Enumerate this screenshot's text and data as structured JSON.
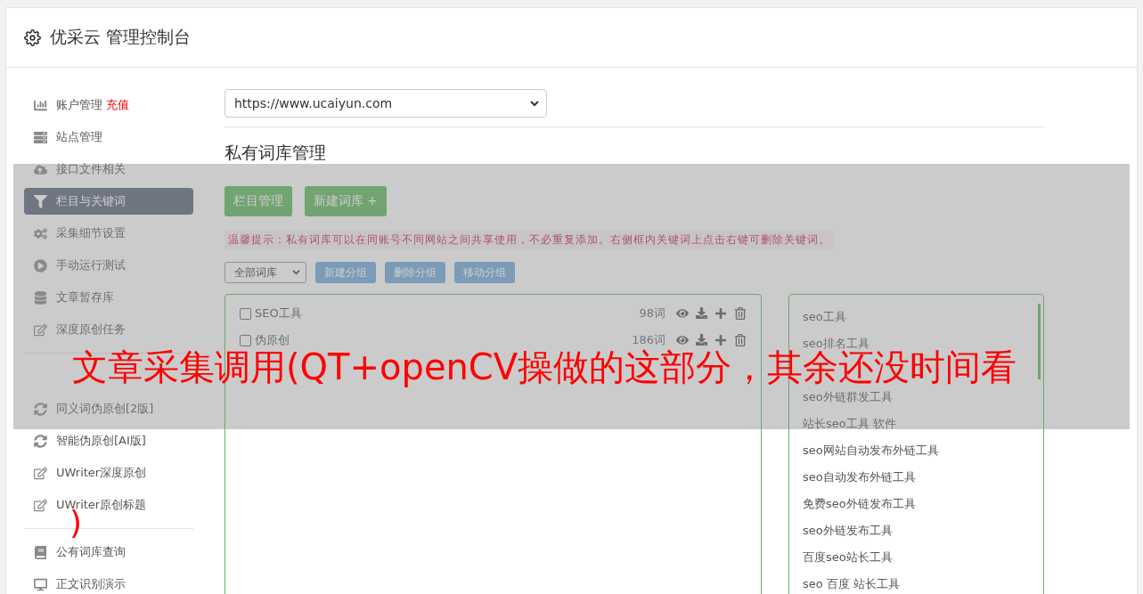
{
  "header": {
    "title": "优采云 管理控制台"
  },
  "sidebar": {
    "groups": [
      [
        {
          "label": "账户管理",
          "badge": "充值",
          "selected": false
        },
        {
          "label": "站点管理",
          "selected": false
        },
        {
          "label": "接口文件相关",
          "selected": false
        },
        {
          "label": "栏目与关键词",
          "selected": true
        },
        {
          "label": "采集细节设置",
          "selected": false
        },
        {
          "label": "手动运行测试",
          "selected": false
        },
        {
          "label": "文章暂存库",
          "selected": false
        },
        {
          "label": "深度原创任务",
          "selected": false
        }
      ],
      [
        {
          "kind": "covered"
        },
        {
          "label": "同义词伪原创[2版]",
          "selected": false
        },
        {
          "label": "智能伪原创[AI版]",
          "selected": false
        },
        {
          "label": "UWriter深度原创",
          "selected": false
        },
        {
          "label": "UWriter原创标题",
          "selected": false
        }
      ],
      [
        {
          "label": "公有词库查询",
          "selected": false
        },
        {
          "label": "正文识别演示",
          "selected": false
        }
      ]
    ]
  },
  "site_select": {
    "value": "https://www.ucaiyun.com"
  },
  "section_title": "私有词库管理",
  "action_buttons": [
    "栏目管理",
    "新建词库 +"
  ],
  "hint": "温馨提示：私有词库可以在同账号不同网站之间共享使用，不必重复添加。右侧框内关键词上点击右键可删除关键词。",
  "group_select": {
    "value": "全部词库"
  },
  "group_buttons": [
    "新建分组",
    "删除分组",
    "移动分组"
  ],
  "libraries": [
    {
      "name": "SEO工具",
      "count": "98词",
      "checked": false
    },
    {
      "name": "伪原创",
      "count": "186词",
      "checked": false
    },
    {
      "kind": "covered"
    }
  ],
  "keywords": [
    "seo工具",
    "seo排名工具",
    {
      "kind": "covered"
    },
    "seo外链群发工具",
    "站长seo工具 软件",
    "seo网站自动发布外链工具",
    "seo自动发布外链工具",
    "免费seo外链发布工具",
    "seo外链发布工具",
    "百度seo站长工具",
    "seo 百度 站长工具"
  ],
  "overlay": {
    "caption": "文章采集调用(QT+openCV操做的这部分，其余还没时间看",
    "caption_tail": ")"
  }
}
